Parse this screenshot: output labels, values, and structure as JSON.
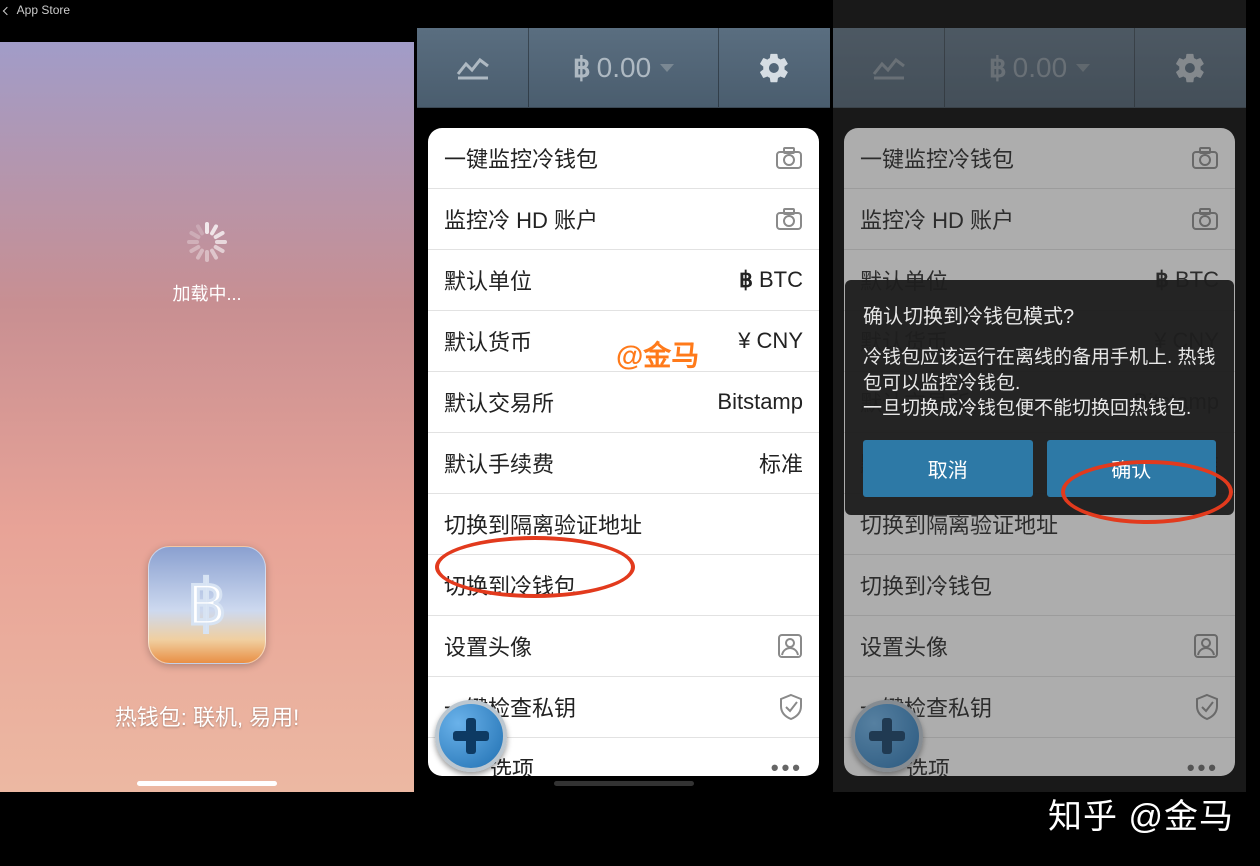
{
  "statusbar": {
    "back_label": "App Store"
  },
  "loading": {
    "text": "加载中...",
    "tagline": "热钱包: 联机, 易用!"
  },
  "topbar": {
    "balance": "0.00"
  },
  "settings": {
    "monitor_cold": "一键监控冷钱包",
    "monitor_hd": "监控冷 HD 账户",
    "default_unit_label": "默认单位",
    "default_unit_value": "BTC",
    "default_currency_label": "默认货币",
    "default_currency_value": "CNY",
    "currency_symbol": "¥",
    "default_exchange_label": "默认交易所",
    "default_exchange_value": "Bitstamp",
    "default_fee_label": "默认手续费",
    "default_fee_value": "标准",
    "switch_segwit": "切换到隔离验证地址",
    "switch_cold": "切换到冷钱包",
    "set_avatar": "设置头像",
    "check_private_key": "一键检查私钥",
    "advanced_options": "高级选项",
    "advanced_options_short": "选项"
  },
  "dialog": {
    "title": "确认切换到冷钱包模式?",
    "body": "冷钱包应该运行在离线的备用手机上. 热钱包可以监控冷钱包.\n一旦切换成冷钱包便不能切换回热钱包.",
    "cancel": "取消",
    "confirm": "确认"
  },
  "watermark_center": "@金马",
  "watermark_corner": "知乎 @金马"
}
